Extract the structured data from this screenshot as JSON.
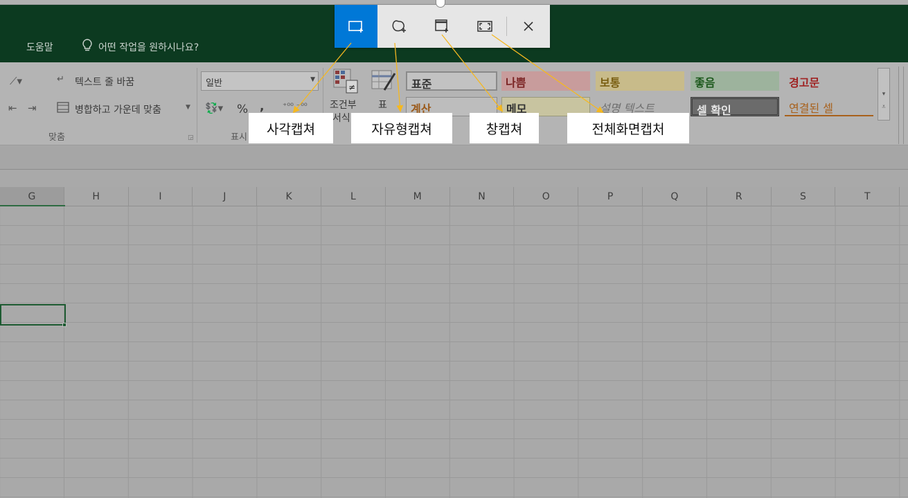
{
  "ribbon": {
    "tab_help": "도움말",
    "tell_me": "어떤 작업을 원하시나요?",
    "wrap_text": "텍스트 줄 바꿈",
    "merge_center": "병합하고 가운데 맞춤",
    "group_alignment": "맞춤",
    "group_number_partial": "표시",
    "number_format": "일반",
    "percent": "%",
    "comma": ",",
    "cond_format_line1": "조건부",
    "cond_format_line2": "서식",
    "format_table": "표",
    "styles": {
      "normal": "표준",
      "bad": "나쁨",
      "neutral": "보통",
      "good": "좋음",
      "warning": "경고문",
      "calculation": "계산",
      "note": "메모",
      "explanatory": "설명 텍스트",
      "check_cell": "셀 확인",
      "linked_cell": "연결된 셀"
    }
  },
  "columns": [
    "G",
    "H",
    "I",
    "J",
    "K",
    "L",
    "M",
    "N",
    "O",
    "P",
    "Q",
    "R",
    "S",
    "T"
  ],
  "snip_toolbar": {
    "rect_icon": "rectangle-snip-icon",
    "free_icon": "freeform-snip-icon",
    "window_icon": "window-snip-icon",
    "full_icon": "fullscreen-snip-icon",
    "close_icon": "close-icon",
    "active_color": "#0078d7"
  },
  "labels": {
    "rect_capture": "사각캡쳐",
    "free_capture": "자유형캡쳐",
    "window_capture": "창캡쳐",
    "full_capture": "전체화면캡처"
  },
  "colors": {
    "arrow": "#f5b820",
    "ribbon_green": "#0c3a20"
  }
}
